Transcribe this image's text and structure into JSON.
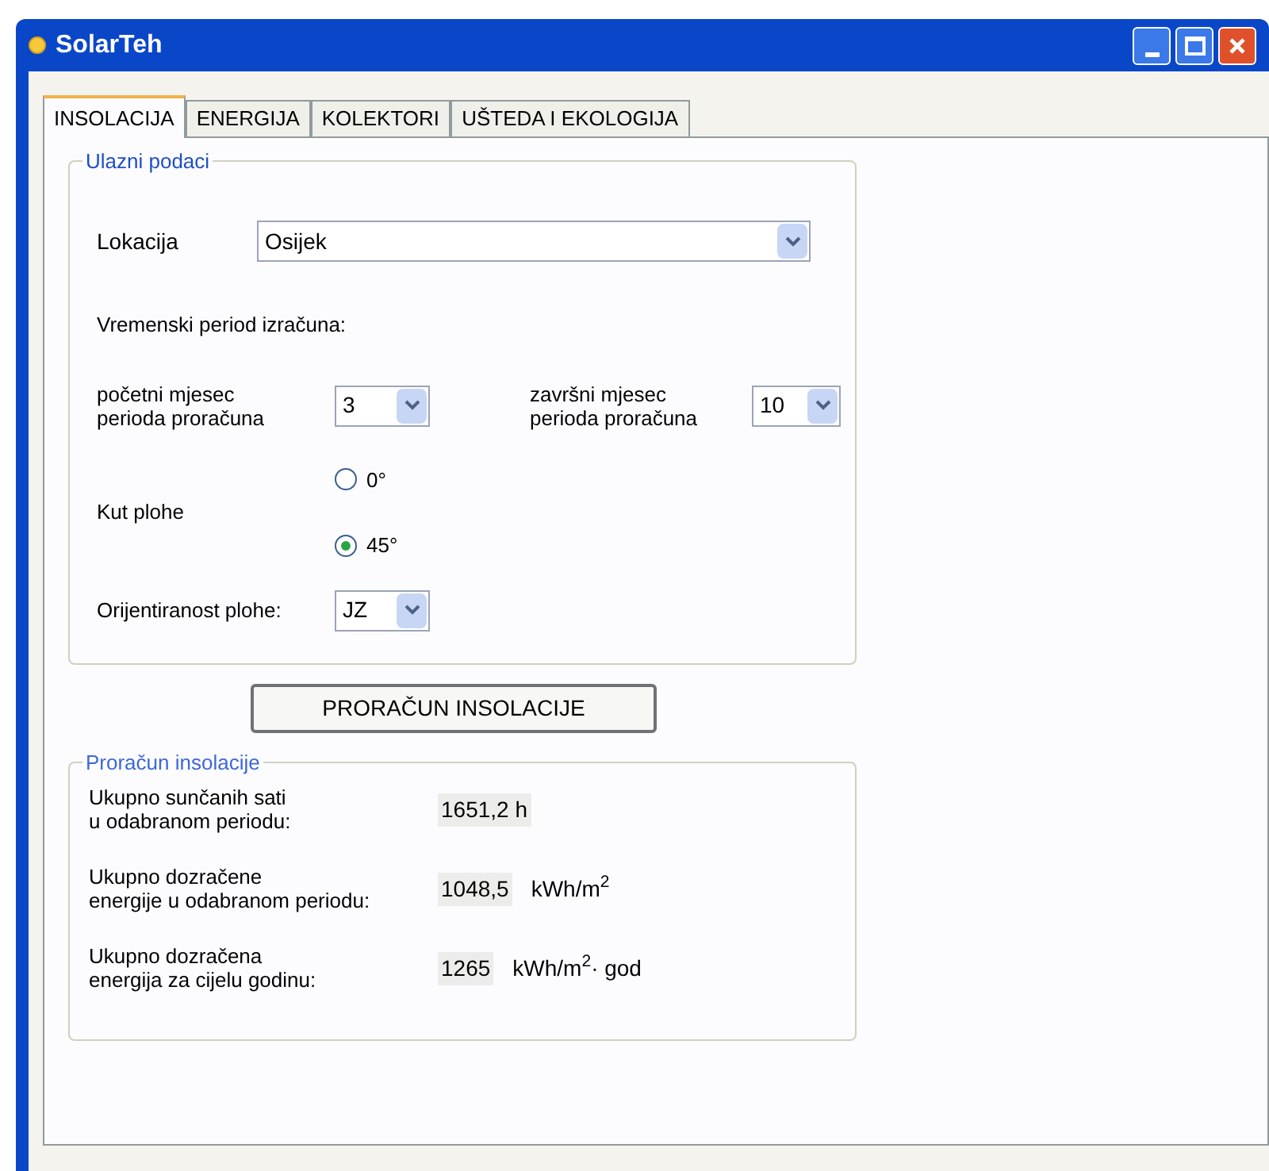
{
  "window": {
    "title": "SolarTeh"
  },
  "tabs": [
    {
      "label": "INSOLACIJA",
      "selected": true
    },
    {
      "label": "ENERGIJA",
      "selected": false
    },
    {
      "label": "KOLEKTORI",
      "selected": false
    },
    {
      "label": "UŠTEDA I EKOLOGIJA",
      "selected": false
    }
  ],
  "input_group": {
    "title": "Ulazni podaci",
    "location": {
      "label": "Lokacija",
      "value": "Osijek"
    },
    "period_heading": "Vremenski period izračuna:",
    "start_month": {
      "label_lines": [
        "početni mjesec",
        "perioda proračuna"
      ],
      "value": "3"
    },
    "end_month": {
      "label_lines": [
        "završni mjesec",
        "perioda proračuna"
      ],
      "value": "10"
    },
    "angle": {
      "label": "Kut plohe",
      "options": [
        {
          "label": "0°",
          "selected": false
        },
        {
          "label": "45°",
          "selected": true
        }
      ]
    },
    "orientation": {
      "label": "Orijentiranost plohe:",
      "value": "JZ"
    }
  },
  "calculate_button": "PRORAČUN INSOLACIJE",
  "results_group": {
    "title": "Proračun insolacije",
    "rows": [
      {
        "label_lines": [
          "Ukupno sunčanih sati",
          "u odabranom periodu:"
        ],
        "value": "1651,2 h",
        "unit": ""
      },
      {
        "label_lines": [
          "Ukupno dozračene",
          "energije u odabranom periodu:"
        ],
        "value": "1048,5",
        "unit": "kWh/m$^{2}$"
      },
      {
        "label_lines": [
          "Ukupno dozračena",
          "energija za cijelu godinu:"
        ],
        "value": "1265",
        "unit": "kWh/m$^{2}$· god"
      }
    ]
  }
}
